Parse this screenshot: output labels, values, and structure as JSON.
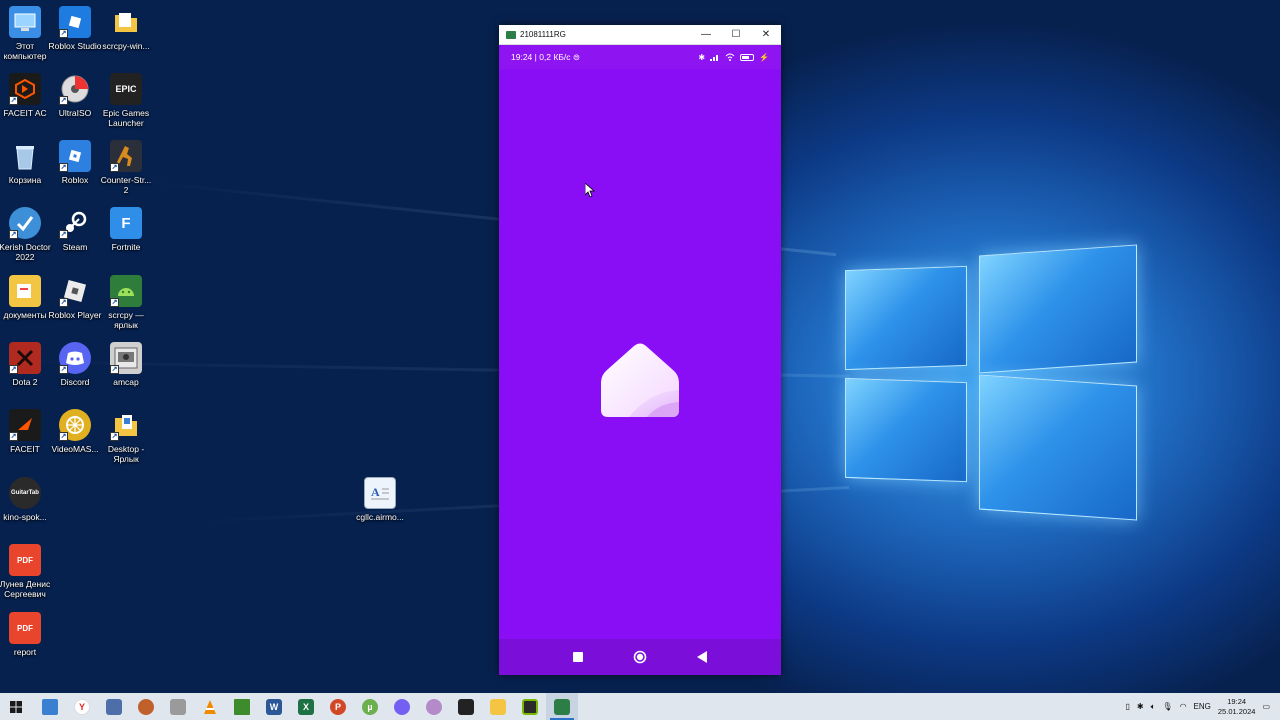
{
  "desktop": {
    "icons": [
      {
        "label": "Этот компьютер",
        "icon": "computer-icon",
        "color": "#3a8ee6"
      },
      {
        "label": "Roblox Studio",
        "icon": "roblox-studio-icon",
        "color": "#1e7be0"
      },
      {
        "label": "scrcpy-win...",
        "icon": "folder-icon",
        "color": "#f4c542"
      },
      {
        "label": "FACEIT AC",
        "icon": "faceit-ac-icon",
        "color": "#1a1a1a"
      },
      {
        "label": "UltraISO",
        "icon": "ultraiso-icon",
        "color": "#e8e8e8"
      },
      {
        "label": "Epic Games Launcher",
        "icon": "epic-games-icon",
        "color": "#222222"
      },
      {
        "label": "Корзина",
        "icon": "recycle-bin-icon",
        "color": "#7aa6d6"
      },
      {
        "label": "Roblox",
        "icon": "roblox-icon",
        "color": "#2d7fe0"
      },
      {
        "label": "Counter-Str... 2",
        "icon": "cs2-icon",
        "color": "#d98a1c"
      },
      {
        "label": "Kerish Doctor 2022",
        "icon": "kerish-doctor-icon",
        "color": "#3d8fd8"
      },
      {
        "label": "Steam",
        "icon": "steam-icon",
        "color": "#1b2838"
      },
      {
        "label": "Fortnite",
        "icon": "fortnite-icon",
        "color": "#2f8fe8"
      },
      {
        "label": "документы",
        "icon": "folder-documents-icon",
        "color": "#f4c542"
      },
      {
        "label": "Roblox Player",
        "icon": "roblox-player-icon",
        "color": "#ececec"
      },
      {
        "label": "scrcpy — ярлык",
        "icon": "android-icon",
        "color": "#2f7d3a"
      },
      {
        "label": "Dota 2",
        "icon": "dota2-icon",
        "color": "#b02a1f"
      },
      {
        "label": "Discord",
        "icon": "discord-icon",
        "color": "#5865f2"
      },
      {
        "label": "amcap",
        "icon": "amcap-icon",
        "color": "#cfcfcf"
      },
      {
        "label": "FACEIT",
        "icon": "faceit-icon",
        "color": "#1a1a1a"
      },
      {
        "label": "VideoMAS...",
        "icon": "videomaster-icon",
        "color": "#e0b020"
      },
      {
        "label": "Desktop - Ярлык",
        "icon": "folder-shortcut-icon",
        "color": "#f4c542"
      },
      {
        "label": "kino-spok...",
        "icon": "guitar-tab-icon",
        "color": "#2a2a2a"
      },
      {
        "label": "cgllc.airmo...",
        "icon": "text-document-icon",
        "color": "#cfe2f5"
      },
      {
        "label": "Лунев Денис Сергеевич",
        "icon": "pdf-icon",
        "color": "#e8452c"
      },
      {
        "label": "report",
        "icon": "pdf-icon",
        "color": "#e8452c"
      }
    ],
    "icon_glyphs": {
      "epic": "EPIC",
      "fortnite": "F",
      "pdf": "PDF",
      "guitar": "GuitarTab"
    }
  },
  "scrcpy": {
    "title": "21081111RG",
    "minimize": "—",
    "maximize": "☐",
    "close": "✕",
    "status_text": "19:24 | 0,2 КБ/с ⊜",
    "app_background": "#8a0ef5"
  },
  "taskbar": {
    "apps": [
      {
        "name": "start",
        "icon": "windows-start-icon",
        "color": "#1a1a1a"
      },
      {
        "name": "explorer-window",
        "icon": "window-icon",
        "color": "#3a7fd0"
      },
      {
        "name": "yandex",
        "icon": "yandex-browser-icon",
        "color": "#e52620"
      },
      {
        "name": "calculator",
        "icon": "calculator-icon",
        "color": "#4d6ea8"
      },
      {
        "name": "app-lion",
        "icon": "lion-icon",
        "color": "#c0602a"
      },
      {
        "name": "app-gear",
        "icon": "tool-icon",
        "color": "#8a8a8a"
      },
      {
        "name": "vlc",
        "icon": "vlc-icon",
        "color": "#f08a00"
      },
      {
        "name": "minecraft",
        "icon": "minecraft-icon",
        "color": "#3e8b2e"
      },
      {
        "name": "word",
        "icon": "word-icon",
        "color": "#2b5797"
      },
      {
        "name": "excel",
        "icon": "excel-icon",
        "color": "#1e7145"
      },
      {
        "name": "powerpoint",
        "icon": "powerpoint-icon",
        "color": "#d24726"
      },
      {
        "name": "utorrent",
        "icon": "utorrent-icon",
        "color": "#6ab04c"
      },
      {
        "name": "viber",
        "icon": "viber-icon",
        "color": "#7360f2"
      },
      {
        "name": "app-feather",
        "icon": "feather-icon",
        "color": "#9a6ab0"
      },
      {
        "name": "obs",
        "icon": "camera-app-icon",
        "color": "#222222"
      },
      {
        "name": "file-explorer",
        "icon": "folder-icon",
        "color": "#f4c542"
      },
      {
        "name": "nvidia",
        "icon": "nvidia-icon",
        "color": "#2a2a2a"
      },
      {
        "name": "scrcpy",
        "icon": "scrcpy-icon",
        "color": "#2d7d46"
      }
    ],
    "tray": {
      "language": "ENG",
      "time": "19:24",
      "date": "25.01.2024"
    }
  }
}
